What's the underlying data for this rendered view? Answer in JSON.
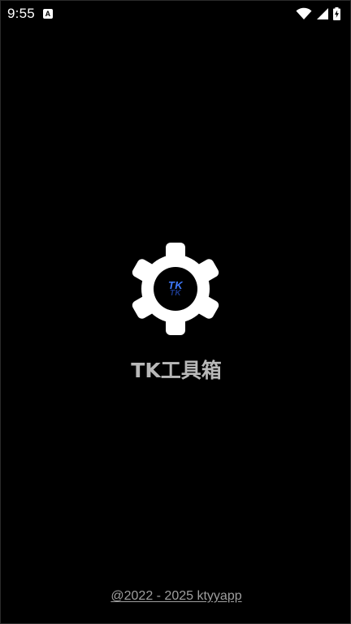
{
  "status_bar": {
    "time": "9:55",
    "notification_badge": "A",
    "icons": [
      "wifi-icon",
      "signal-icon",
      "battery-charging-icon"
    ]
  },
  "splash": {
    "logo_text": "TK",
    "logo_text_ghost": "TK",
    "logo_icon": "gear-icon",
    "app_name": "TK工具箱",
    "copyright": "@2022 - 2025 ktyyapp"
  },
  "colors": {
    "background": "#000000",
    "gear": "#ffffff",
    "logo_text": "#3f7bff",
    "app_name": "#b8b8b8",
    "copyright": "#9e9e9e"
  }
}
